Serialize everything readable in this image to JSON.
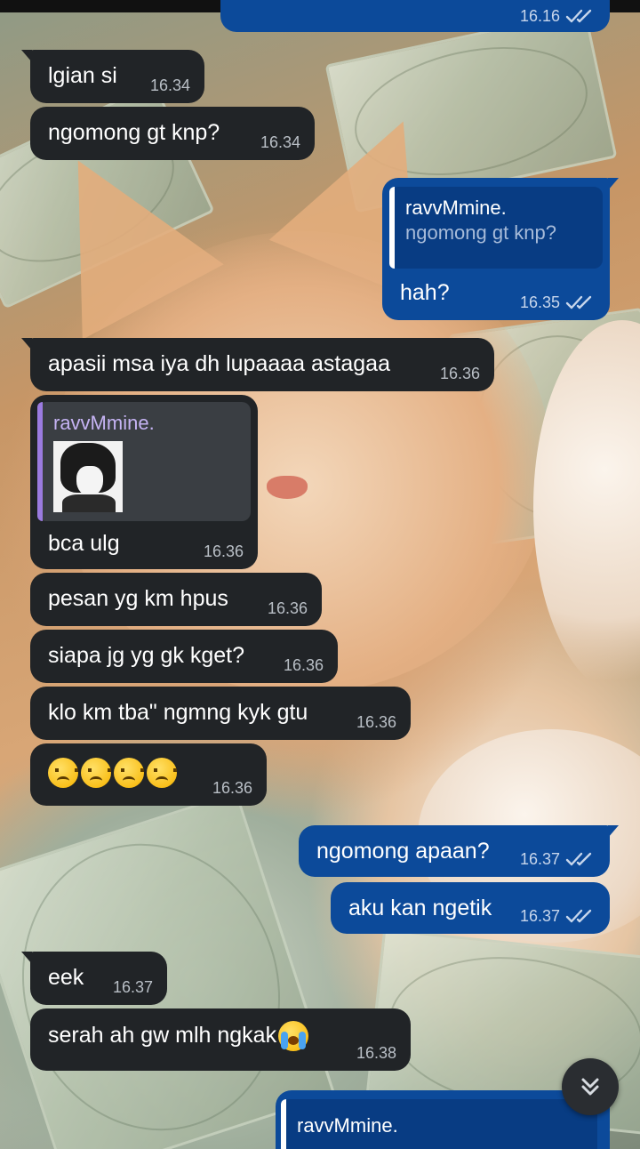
{
  "chat": {
    "top_partial": {
      "time": "16.16"
    },
    "messages": [
      {
        "text": "lgian si",
        "time": "16.34"
      },
      {
        "text": "ngomong gt knp?",
        "time": "16.34"
      },
      {
        "reply_name": "ravvMmine.",
        "reply_text": "ngomong gt knp?",
        "text": "hah?",
        "time": "16.35"
      },
      {
        "text": "apasii msa iya dh lupaaaa astagaa",
        "time": "16.36"
      },
      {
        "reply_name": "ravvMmine.",
        "text": "bca ulg",
        "time": "16.36"
      },
      {
        "text": "pesan yg km hpus",
        "time": "16.36"
      },
      {
        "text": "siapa jg yg gk kget?",
        "time": "16.36"
      },
      {
        "text": "klo km tba\" ngmng kyk gtu",
        "time": "16.36"
      },
      {
        "time": "16.36"
      },
      {
        "text": "ngomong apaan?",
        "time": "16.37"
      },
      {
        "text": "aku kan ngetik",
        "time": "16.37"
      },
      {
        "text": "eek",
        "time": "16.37"
      },
      {
        "text": "serah ah gw mlh ngkak",
        "time": "16.38"
      },
      {
        "reply_name": "ravvMmine."
      }
    ]
  },
  "icons": {
    "read": "double-check-icon",
    "sad": "sad-face-emoji",
    "cry": "loudly-crying-face-emoji",
    "scroll": "chevrons-down-icon"
  },
  "colors": {
    "incoming_bubble": "#212427",
    "outgoing_bubble": "#0c4a9a",
    "reply_accent_incoming": "#9b7be0"
  }
}
